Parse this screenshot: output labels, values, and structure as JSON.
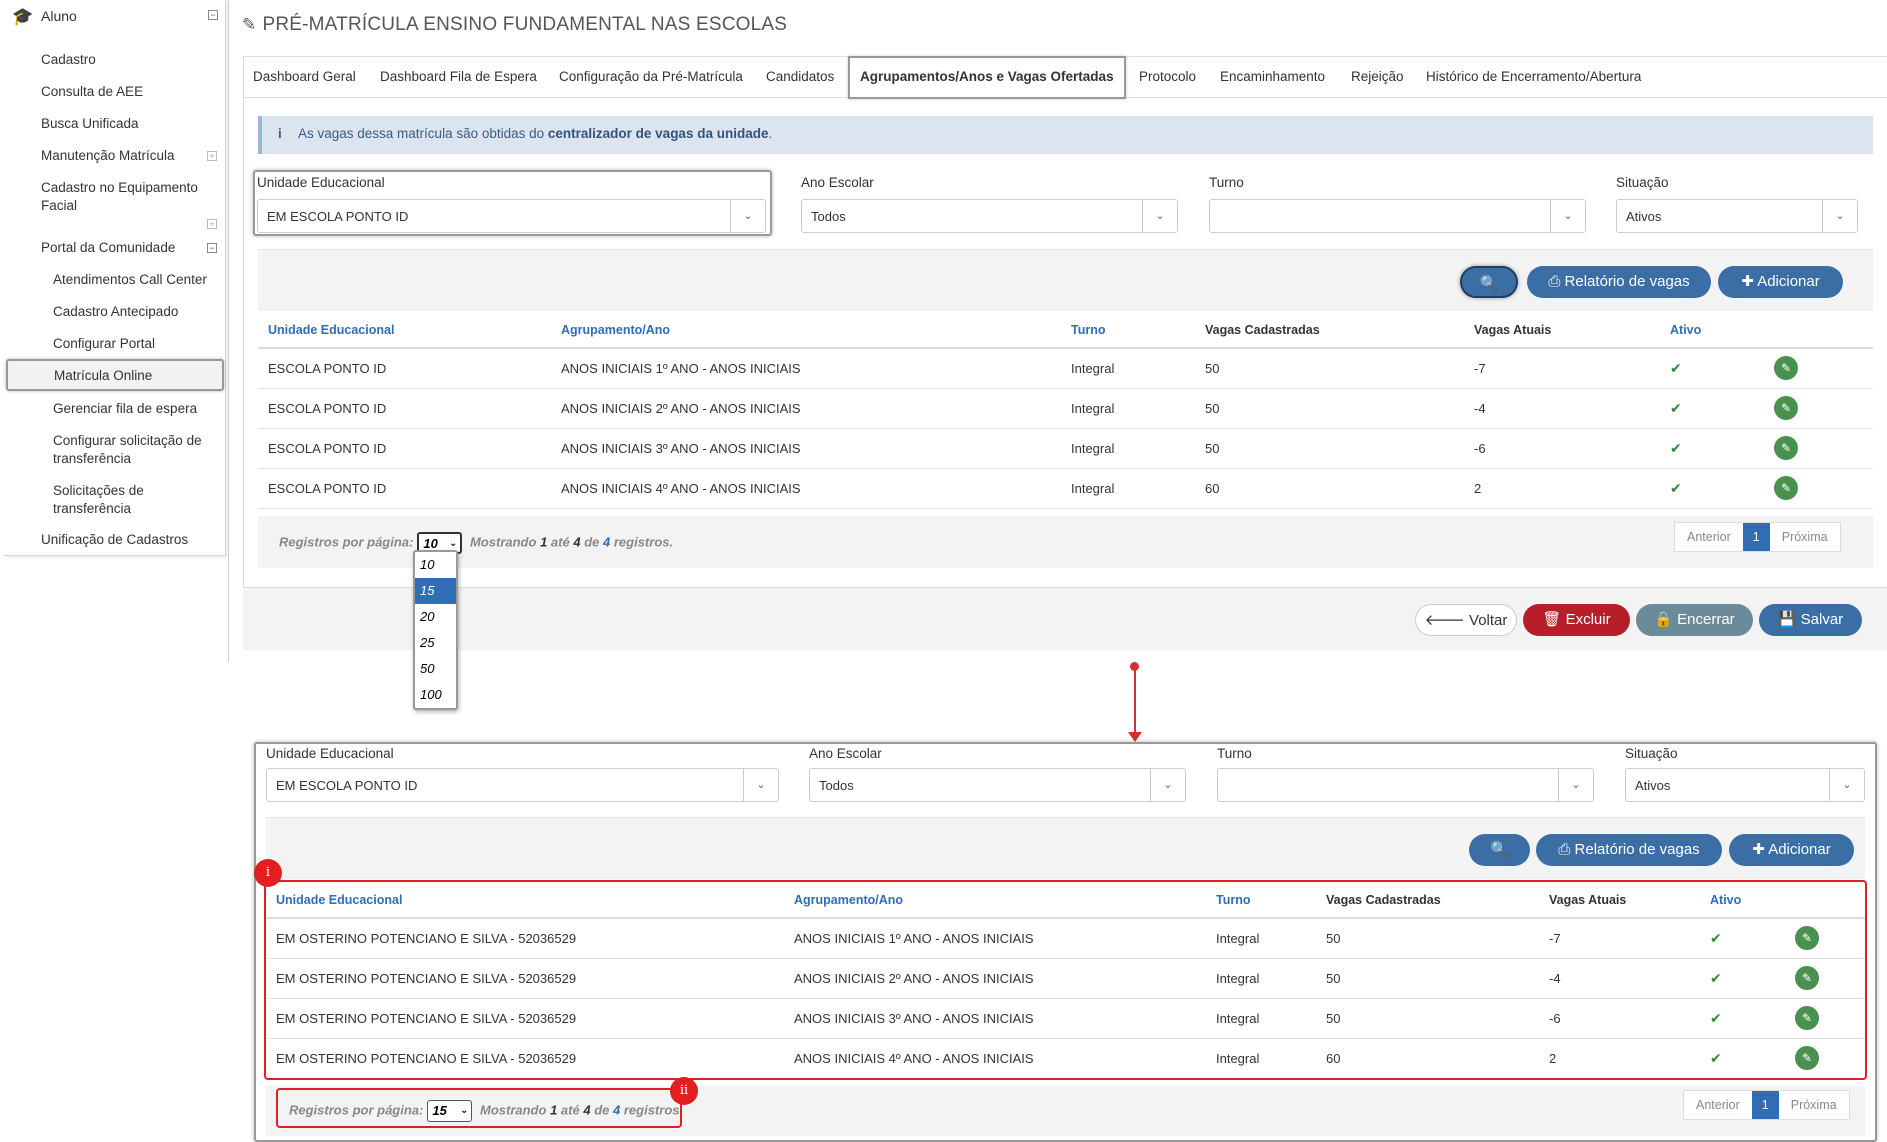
{
  "sidebar": {
    "header": "Aluno",
    "items": [
      {
        "label": "Cadastro"
      },
      {
        "label": "Consulta de AEE"
      },
      {
        "label": "Busca Unificada"
      },
      {
        "label": "Manutenção Matrícula"
      },
      {
        "label": "Cadastro no Equipamento Facial"
      },
      {
        "label": "Portal da Comunidade"
      },
      {
        "label": "Atendimentos Call Center"
      },
      {
        "label": "Cadastro Antecipado"
      },
      {
        "label": "Configurar Portal"
      },
      {
        "label": "Matrícula Online"
      },
      {
        "label": "Gerenciar fila de espera"
      },
      {
        "label": "Configurar solicitação de transferência"
      },
      {
        "label": "Solicitações de transferência"
      },
      {
        "label": "Unificação de Cadastros"
      }
    ]
  },
  "page": {
    "title": "PRÉ-MATRÍCULA ENSINO FUNDAMENTAL NAS ESCOLAS"
  },
  "tabs": [
    {
      "label": "Dashboard Geral"
    },
    {
      "label": "Dashboard Fila de Espera"
    },
    {
      "label": "Configuração da Pré-Matrícula"
    },
    {
      "label": "Candidatos"
    },
    {
      "label": "Agrupamentos/Anos e Vagas Ofertadas"
    },
    {
      "label": "Protocolo"
    },
    {
      "label": "Encaminhamento"
    },
    {
      "label": "Rejeição"
    },
    {
      "label": "Histórico de Encerramento/Abertura"
    }
  ],
  "info": {
    "text": "As vagas dessa matrícula são obtidas do ",
    "bold": "centralizador de vagas da unidade",
    "end": "."
  },
  "filters": {
    "unidade": {
      "label": "Unidade Educacional",
      "value": "EM ESCOLA PONTO ID"
    },
    "ano": {
      "label": "Ano Escolar",
      "value": "Todos"
    },
    "turno": {
      "label": "Turno",
      "value": ""
    },
    "situacao": {
      "label": "Situação",
      "value": "Ativos"
    }
  },
  "buttons": {
    "relatorio": "Relatório de vagas",
    "adicionar": "Adicionar",
    "voltar": "Voltar",
    "excluir": "Excluir",
    "encerrar": "Encerrar",
    "salvar": "Salvar"
  },
  "table": {
    "headers": [
      "Unidade Educacional",
      "Agrupamento/Ano",
      "Turno",
      "Vagas Cadastradas",
      "Vagas Atuais",
      "Ativo"
    ],
    "rows": [
      {
        "unidade": "ESCOLA PONTO ID",
        "agrupamento": "ANOS INICIAIS 1º ANO - ANOS INICIAIS",
        "turno": "Integral",
        "cadastradas": "50",
        "atuais": "-7"
      },
      {
        "unidade": "ESCOLA PONTO ID",
        "agrupamento": "ANOS INICIAIS 2º ANO - ANOS INICIAIS",
        "turno": "Integral",
        "cadastradas": "50",
        "atuais": "-4"
      },
      {
        "unidade": "ESCOLA PONTO ID",
        "agrupamento": "ANOS INICIAIS 3º ANO - ANOS INICIAIS",
        "turno": "Integral",
        "cadastradas": "50",
        "atuais": "-6"
      },
      {
        "unidade": "ESCOLA PONTO ID",
        "agrupamento": "ANOS INICIAIS 4º ANO - ANOS INICIAIS",
        "turno": "Integral",
        "cadastradas": "60",
        "atuais": "2"
      }
    ]
  },
  "pagination": {
    "per_page_label": "Registros por página:",
    "per_page_value": "10",
    "showing": "Mostrando",
    "from": "1",
    "until": "até",
    "to": "4",
    "of": "de",
    "total": "4",
    "records": "registros.",
    "prev": "Anterior",
    "current": "1",
    "next": "Próxima"
  },
  "dropdown_options": [
    "10",
    "15",
    "20",
    "25",
    "50",
    "100"
  ],
  "dropdown_selected": "15",
  "zoom": {
    "filters": {
      "unidade": {
        "label": "Unidade Educacional",
        "value": "EM ESCOLA PONTO ID"
      },
      "ano": {
        "label": "Ano Escolar",
        "value": "Todos"
      },
      "turno": {
        "label": "Turno",
        "value": ""
      },
      "situacao": {
        "label": "Situação",
        "value": "Ativos"
      }
    },
    "rows": [
      {
        "unidade": "EM OSTERINO POTENCIANO E SILVA - 52036529",
        "agrupamento": "ANOS INICIAIS 1º ANO - ANOS INICIAIS",
        "turno": "Integral",
        "cadastradas": "50",
        "atuais": "-7"
      },
      {
        "unidade": "EM OSTERINO POTENCIANO E SILVA - 52036529",
        "agrupamento": "ANOS INICIAIS 2º ANO - ANOS INICIAIS",
        "turno": "Integral",
        "cadastradas": "50",
        "atuais": "-4"
      },
      {
        "unidade": "EM OSTERINO POTENCIANO E SILVA - 52036529",
        "agrupamento": "ANOS INICIAIS 3º ANO - ANOS INICIAIS",
        "turno": "Integral",
        "cadastradas": "50",
        "atuais": "-6"
      },
      {
        "unidade": "EM OSTERINO POTENCIANO E SILVA - 52036529",
        "agrupamento": "ANOS INICIAIS 4º ANO - ANOS INICIAIS",
        "turno": "Integral",
        "cadastradas": "60",
        "atuais": "2"
      }
    ],
    "per_page_value": "15",
    "badge_i": "i",
    "badge_ii": "ii"
  }
}
